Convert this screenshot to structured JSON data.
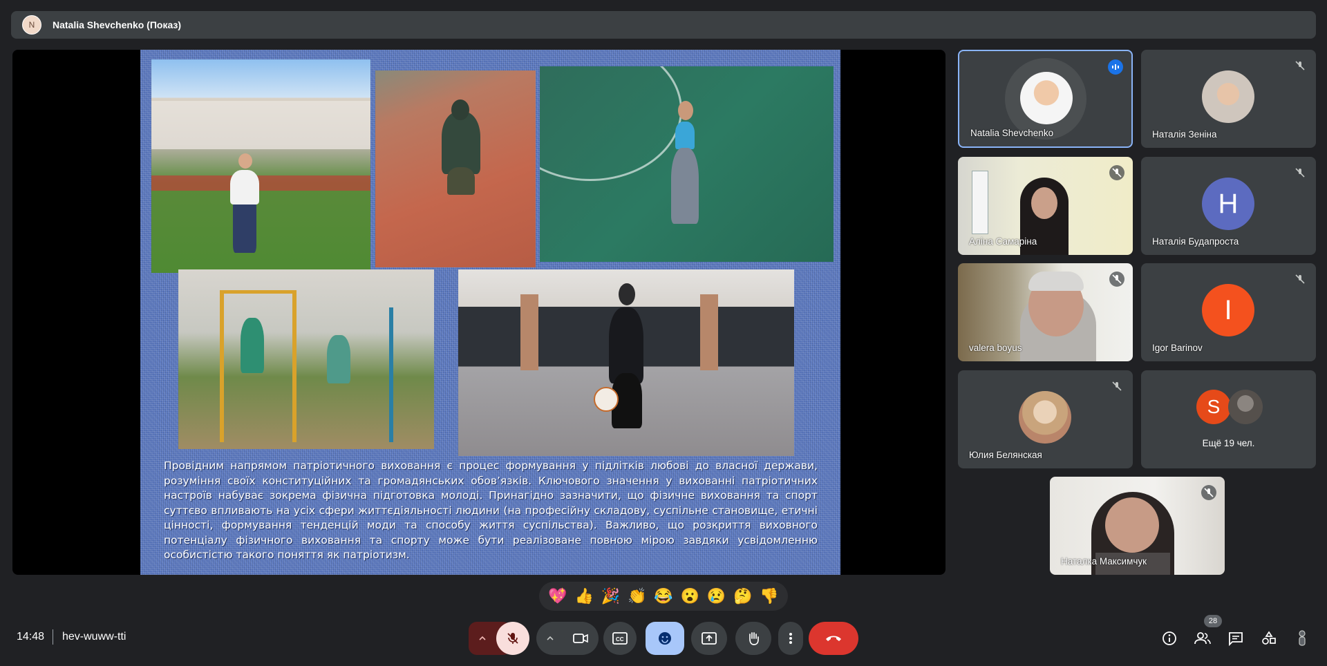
{
  "presenter_bar": {
    "avatar_initial": "N",
    "label": "Natalia Shevchenko (Показ)"
  },
  "slide": {
    "paragraph": "Провідним напрямом патріотичного виховання є процес формування у підлітків любові до власної держави, розуміння своїх конституційних та громадянських обов’язків. Ключового значення у вихованні патріотичних настроїв набуває зокрема фізична підготовка молоді. Принагідно зазначити, що фізичне виховання та спорт суттєво впливають на усіх сфери життєдіяльності людини (на професійну складову, суспільне становище, етичні цінності, формування тенденцій моди та способу життя суспільства). Важливо, що розкриття виховного потенціалу фізичного виховання та спорту може бути реалізоване повною мірою завдяки усвідомленню особистістю такого поняття як патріотизм."
  },
  "participants": [
    {
      "name": "Natalia Shevchenko",
      "speaking": true,
      "avatar": "photo"
    },
    {
      "name": "Наталія Зеніна",
      "muted": true,
      "avatar": "photo"
    },
    {
      "name": "Аліна Самаріна",
      "muted": true,
      "avatar": "video"
    },
    {
      "name": "Наталія Будапроста",
      "muted": true,
      "avatar": "letter",
      "letter": "Н",
      "color": "#5c6bc0"
    },
    {
      "name": "valera boyus",
      "muted": true,
      "avatar": "video"
    },
    {
      "name": "Igor Barinov",
      "muted": true,
      "avatar": "letter",
      "letter": "I",
      "color": "#f4511e"
    },
    {
      "name": "Юлия Белянская",
      "muted": true,
      "avatar": "photo"
    },
    {
      "name": "Ещё 19 чел.",
      "avatar": "group",
      "letter": "S",
      "color": "#e64a19"
    },
    {
      "name": "Наталка Максимчук",
      "muted": true,
      "avatar": "video"
    }
  ],
  "reactions": [
    "💖",
    "👍",
    "🎉",
    "👏",
    "😂",
    "😮",
    "😢",
    "🤔",
    "👎"
  ],
  "bottom_bar": {
    "time": "14:48",
    "meeting_code": "hev-wuww-tti",
    "people_count": "28"
  },
  "icons": {
    "mic_off": "mic-off-icon",
    "camera": "camera-icon",
    "captions": "CC",
    "emoji": "emoji-icon",
    "present": "present-icon",
    "hand": "hand-icon",
    "more": "more-icon",
    "end_call": "end-call-icon",
    "info": "info-icon",
    "people": "people-icon",
    "chat": "chat-icon",
    "activities": "activities-icon"
  },
  "colors": {
    "accent_blue": "#8ab4f8",
    "end_call": "#ea4335",
    "mic_off_bg": "#f9dedc",
    "emoji_active": "#a8c7fa"
  }
}
